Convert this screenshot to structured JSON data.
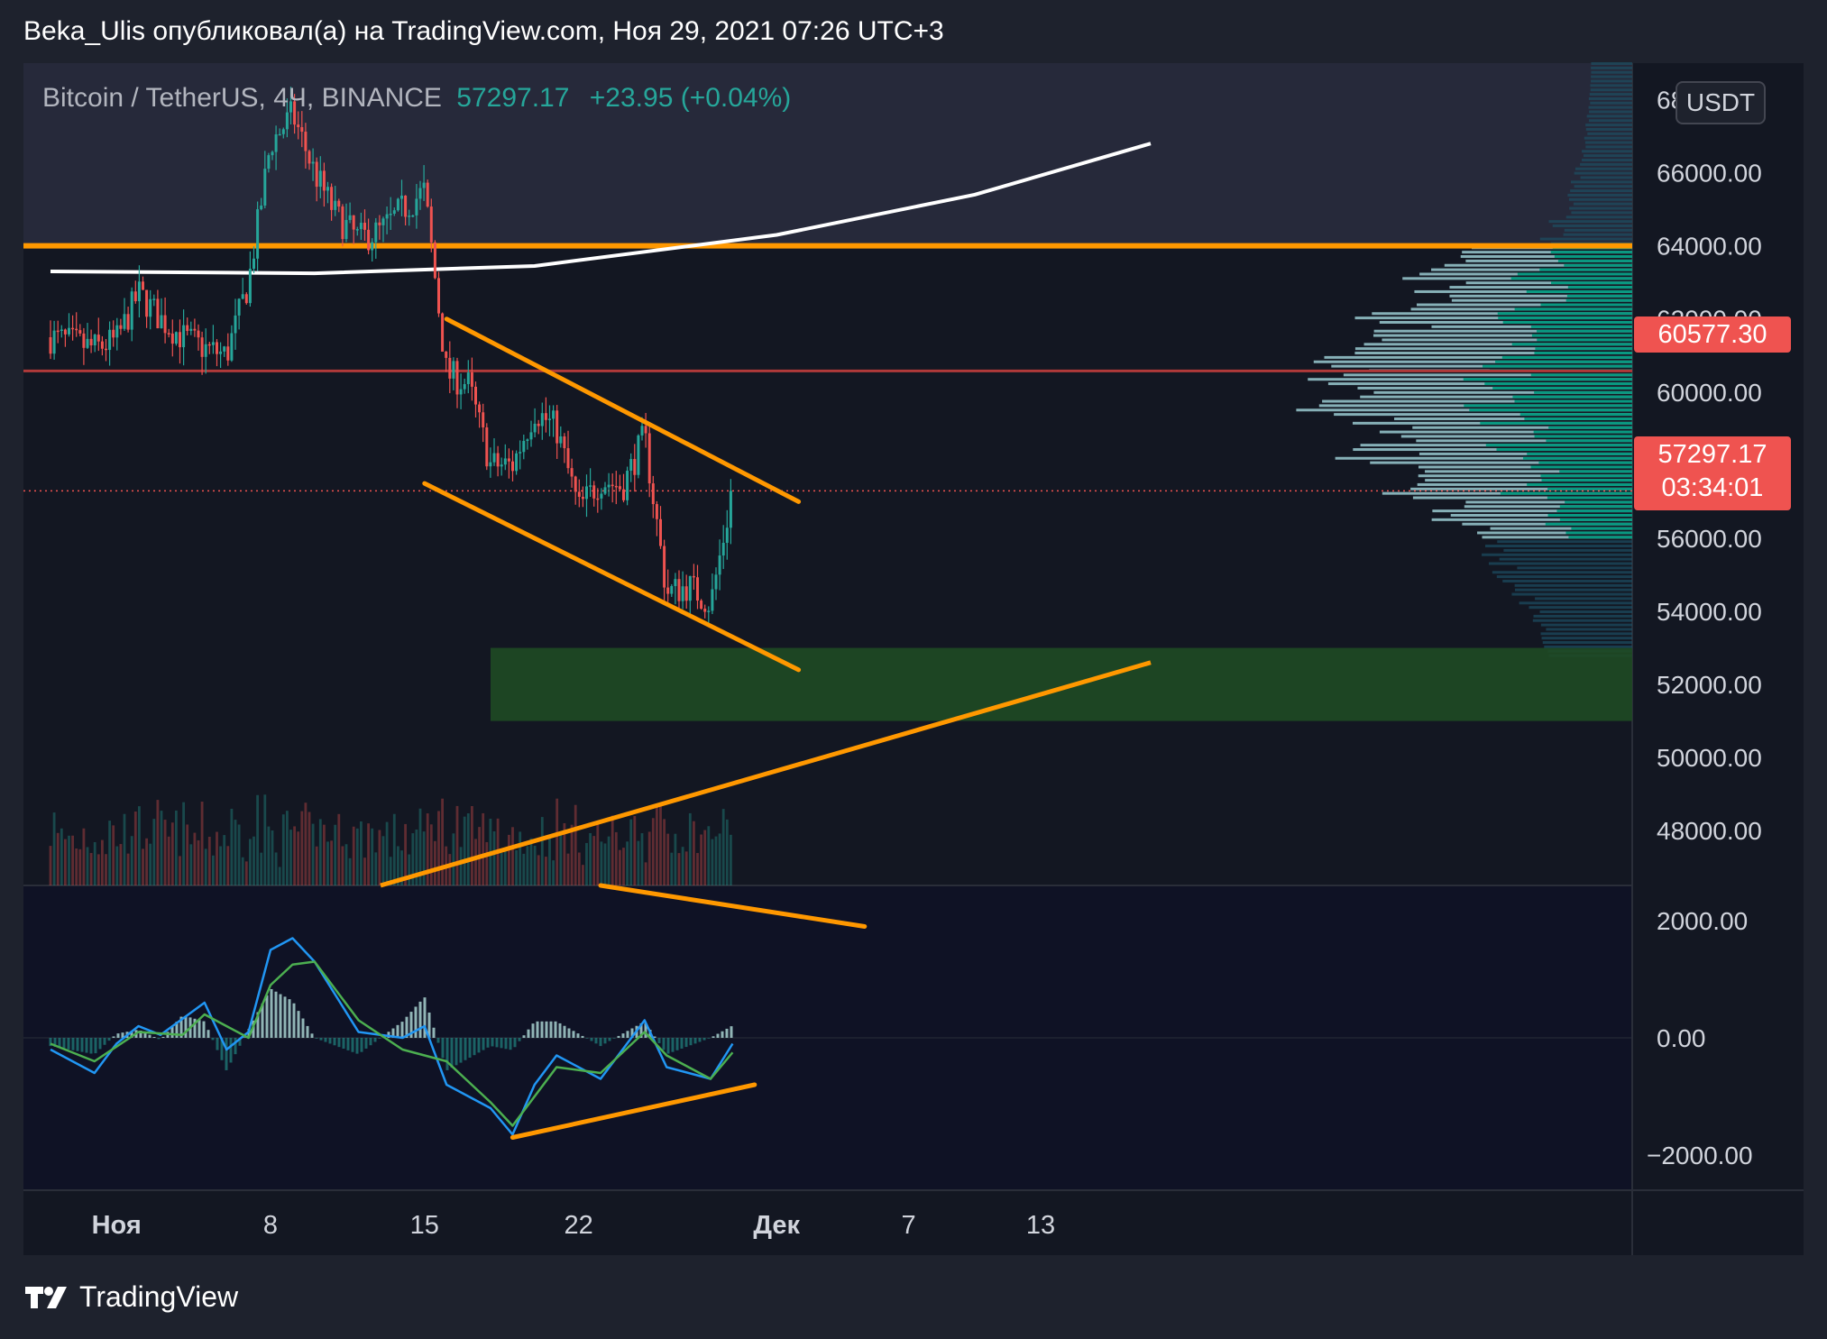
{
  "header": {
    "published": "Beka_Ulis опубликовал(а) на TradingView.com, Ноя 29, 2021 07:26 UTC+3"
  },
  "legend": {
    "symbol": "Bitcoin / TetherUS, 4Ч, BINANCE",
    "price": "57297.17",
    "change": "+23.95 (+0.04%)"
  },
  "currency": "USDT",
  "price_tags": {
    "level": "60577.30",
    "last": "57297.17",
    "countdown": "03:34:01"
  },
  "footer": {
    "brand": "TradingView"
  },
  "colors": {
    "background": "#131722",
    "up": "#26a69a",
    "down": "#ef5350",
    "trendline": "#ff9800",
    "macd": "#2196f3",
    "signal": "#4caf50",
    "demand_zone": "#1f4a24",
    "profile_up": "#089981",
    "profile_light": "#8cb8c0"
  },
  "chart_data": [
    {
      "type": "candlestick",
      "title": "",
      "xlabel": "",
      "ylabel": "",
      "x_ticks": [
        "Ноя",
        "8",
        "15",
        "22",
        "Дек",
        "7",
        "13"
      ],
      "y_ticks": [
        48000,
        50000,
        52000,
        54000,
        56000,
        58000,
        60000,
        62000,
        64000,
        66000,
        68000
      ],
      "y_tick_labels": [
        "48000.00",
        "50000.00",
        "52000.00",
        "54000.00",
        "56000.00",
        "58000.00",
        "60000.00",
        "62000.00",
        "64000.00",
        "66000.00",
        "68000.00"
      ],
      "ylim": [
        46500,
        69000
      ],
      "grid": false,
      "horizontal_levels": [
        {
          "value": 64000,
          "color": "#ff9800"
        },
        {
          "value": 60577.3,
          "color": "#b03a3a"
        },
        {
          "value": 57297.17,
          "color": "#ef5350",
          "style": "dotted"
        }
      ],
      "demand_zone": {
        "from_date": "2021-11-18",
        "y_low": 51000,
        "y_high": 53000
      },
      "channel": [
        {
          "from": [
            "2021-11-16",
            62000
          ],
          "to": [
            "2021-12-02",
            57000
          ]
        },
        {
          "from": [
            "2021-11-15",
            57500
          ],
          "to": [
            "2021-12-02",
            52400
          ]
        }
      ],
      "rising_trendline": {
        "from": [
          "2021-11-13",
          46500
        ],
        "to": [
          "2021-12-18",
          52600
        ]
      },
      "moving_average": [
        {
          "date": "2021-10-29",
          "value": 63300
        },
        {
          "date": "2021-11-10",
          "value": 63250
        },
        {
          "date": "2021-11-20",
          "value": 63450
        },
        {
          "date": "2021-12-01",
          "value": 64300
        },
        {
          "date": "2021-12-10",
          "value": 65400
        },
        {
          "date": "2021-12-18",
          "value": 66800
        }
      ],
      "price_path": [
        {
          "date": "2021-10-29",
          "value": 61500
        },
        {
          "date": "2021-10-31",
          "value": 61200
        },
        {
          "date": "2021-11-01",
          "value": 61400
        },
        {
          "date": "2021-11-02",
          "value": 62700
        },
        {
          "date": "2021-11-03",
          "value": 62000
        },
        {
          "date": "2021-11-04",
          "value": 61500
        },
        {
          "date": "2021-11-05",
          "value": 61200
        },
        {
          "date": "2021-11-06",
          "value": 61000
        },
        {
          "date": "2021-11-07",
          "value": 63000
        },
        {
          "date": "2021-11-08",
          "value": 66800
        },
        {
          "date": "2021-11-09",
          "value": 67600
        },
        {
          "date": "2021-11-10",
          "value": 66000
        },
        {
          "date": "2021-11-11",
          "value": 64800
        },
        {
          "date": "2021-11-12",
          "value": 64200
        },
        {
          "date": "2021-11-13",
          "value": 64400
        },
        {
          "date": "2021-11-14",
          "value": 65000
        },
        {
          "date": "2021-11-15",
          "value": 65500
        },
        {
          "date": "2021-11-16",
          "value": 60500
        },
        {
          "date": "2021-11-17",
          "value": 60200
        },
        {
          "date": "2021-11-18",
          "value": 58000
        },
        {
          "date": "2021-11-19",
          "value": 58000
        },
        {
          "date": "2021-11-20",
          "value": 59500
        },
        {
          "date": "2021-11-21",
          "value": 59000
        },
        {
          "date": "2021-11-22",
          "value": 56800
        },
        {
          "date": "2021-11-23",
          "value": 57600
        },
        {
          "date": "2021-11-24",
          "value": 57400
        },
        {
          "date": "2021-11-25",
          "value": 58800
        },
        {
          "date": "2021-11-26",
          "value": 54500
        },
        {
          "date": "2021-11-27",
          "value": 54700
        },
        {
          "date": "2021-11-28",
          "value": 54200
        },
        {
          "date": "2021-11-29",
          "value": 57297
        }
      ]
    },
    {
      "type": "line",
      "title": "",
      "xlabel": "",
      "ylabel": "",
      "y_ticks": [
        -2000,
        0,
        2000
      ],
      "y_tick_labels": [
        "−2000.00",
        "0.00",
        "2000.00"
      ],
      "ylim": [
        -2600,
        2600
      ],
      "grid": false,
      "series": [
        {
          "color": "#2196f3",
          "points": [
            [
              "2021-10-29",
              -200
            ],
            [
              "2021-10-31",
              -600
            ],
            [
              "2021-11-01",
              -100
            ],
            [
              "2021-11-02",
              200
            ],
            [
              "2021-11-03",
              50
            ],
            [
              "2021-11-05",
              600
            ],
            [
              "2021-11-06",
              -200
            ],
            [
              "2021-11-07",
              100
            ],
            [
              "2021-11-08",
              1500
            ],
            [
              "2021-11-09",
              1700
            ],
            [
              "2021-11-10",
              1300
            ],
            [
              "2021-11-12",
              100
            ],
            [
              "2021-11-14",
              0
            ],
            [
              "2021-11-15",
              200
            ],
            [
              "2021-11-16",
              -800
            ],
            [
              "2021-11-18",
              -1200
            ],
            [
              "2021-11-19",
              -1650
            ],
            [
              "2021-11-20",
              -800
            ],
            [
              "2021-11-21",
              -300
            ],
            [
              "2021-11-23",
              -700
            ],
            [
              "2021-11-25",
              300
            ],
            [
              "2021-11-26",
              -500
            ],
            [
              "2021-11-28",
              -700
            ],
            [
              "2021-11-29",
              -100
            ]
          ]
        },
        {
          "color": "#4caf50",
          "points": [
            [
              "2021-10-29",
              -100
            ],
            [
              "2021-10-31",
              -400
            ],
            [
              "2021-11-02",
              100
            ],
            [
              "2021-11-04",
              50
            ],
            [
              "2021-11-05",
              400
            ],
            [
              "2021-11-07",
              0
            ],
            [
              "2021-11-08",
              900
            ],
            [
              "2021-11-09",
              1250
            ],
            [
              "2021-11-10",
              1300
            ],
            [
              "2021-11-12",
              300
            ],
            [
              "2021-11-14",
              -200
            ],
            [
              "2021-11-16",
              -400
            ],
            [
              "2021-11-18",
              -1100
            ],
            [
              "2021-11-19",
              -1500
            ],
            [
              "2021-11-21",
              -500
            ],
            [
              "2021-11-23",
              -600
            ],
            [
              "2021-11-25",
              100
            ],
            [
              "2021-11-26",
              -300
            ],
            [
              "2021-11-28",
              -700
            ],
            [
              "2021-11-29",
              -250
            ]
          ]
        }
      ],
      "trendlines": [
        {
          "from": [
            "2021-11-19",
            -1700
          ],
          "to": [
            "2021-11-30",
            -800
          ]
        },
        {
          "from": [
            "2021-11-23",
            2600
          ],
          "to": [
            "2021-12-05",
            1900
          ]
        }
      ]
    }
  ]
}
